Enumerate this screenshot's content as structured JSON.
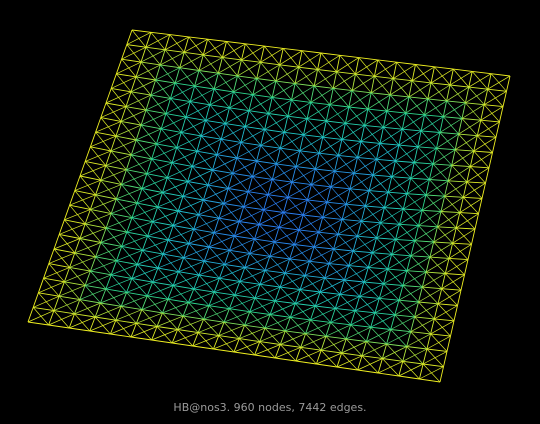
{
  "graph": {
    "caption": "HB@nos3. 960 nodes, 7442 edges.",
    "background_color": "#000000",
    "caption_color": "#9a9a9a",
    "edge_color_scale": [
      "#2e6bff",
      "#1fc8c8",
      "#2fd88a",
      "#c8e830",
      "#f0f020"
    ]
  }
}
